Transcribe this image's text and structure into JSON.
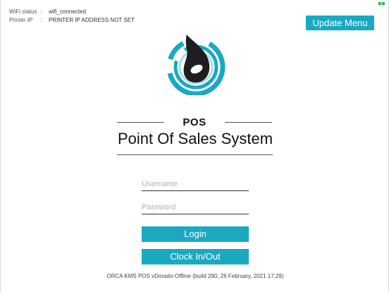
{
  "status": {
    "wifi_label": "WiFi status",
    "wifi_sep": ":",
    "wifi_value": "wifi_connected",
    "printer_label": "Printer IP",
    "printer_sep": ":",
    "printer_value": "PRINTER IP ADDRESS NOT SET"
  },
  "header": {
    "update_menu_label": "Update Menu"
  },
  "brand": {
    "title": "POS",
    "subtitle": "Point Of Sales System",
    "logo_icon": "orca-logo-icon"
  },
  "form": {
    "username_placeholder": "Username",
    "password_placeholder": "Password",
    "login_label": "Login",
    "clock_label": "Clock In/Out"
  },
  "footer": {
    "version_text": "ORCA KMS POS vDorado-Offline (build 290, 26 February, 2021 17:29)"
  },
  "colors": {
    "accent": "#1aa9c1",
    "battery": "#2fb34a",
    "logo_dark": "#1e1e1e"
  }
}
